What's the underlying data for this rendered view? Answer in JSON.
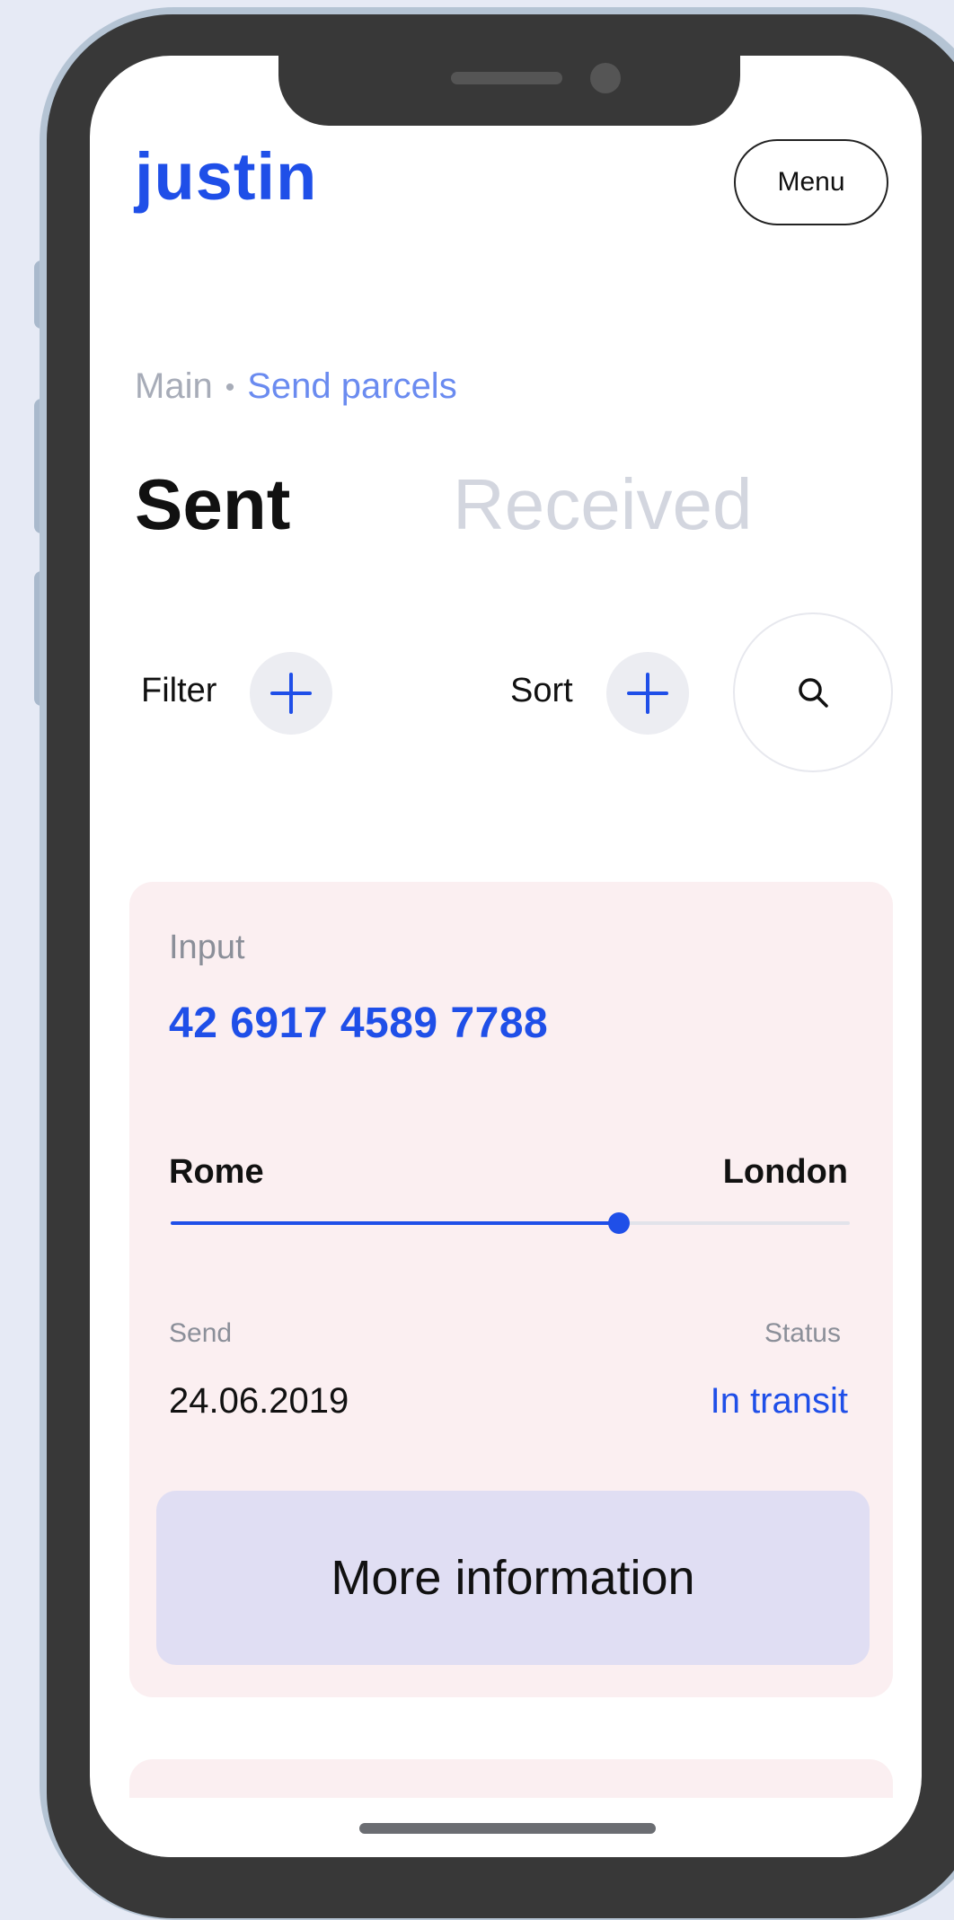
{
  "brand": {
    "logo_text": "justin",
    "accent_color": "#1f4fe8"
  },
  "header": {
    "menu_label": "Menu"
  },
  "breadcrumb": {
    "root": "Main",
    "separator": "•",
    "current": "Send parcels"
  },
  "tabs": [
    {
      "label": "Sent",
      "active": true
    },
    {
      "label": "Received",
      "active": false
    }
  ],
  "controls": {
    "filter_label": "Filter",
    "sort_label": "Sort",
    "plus_icon": "plus-icon",
    "search_icon": "search-icon"
  },
  "parcel": {
    "label": "Input",
    "number": "42 6917 4589 7788",
    "from": "Rome",
    "to": "London",
    "progress": 0.66,
    "send_label": "Send",
    "send_date": "24.06.2019",
    "status_label": "Status",
    "status_value": "In transit",
    "more_button": "More information"
  }
}
